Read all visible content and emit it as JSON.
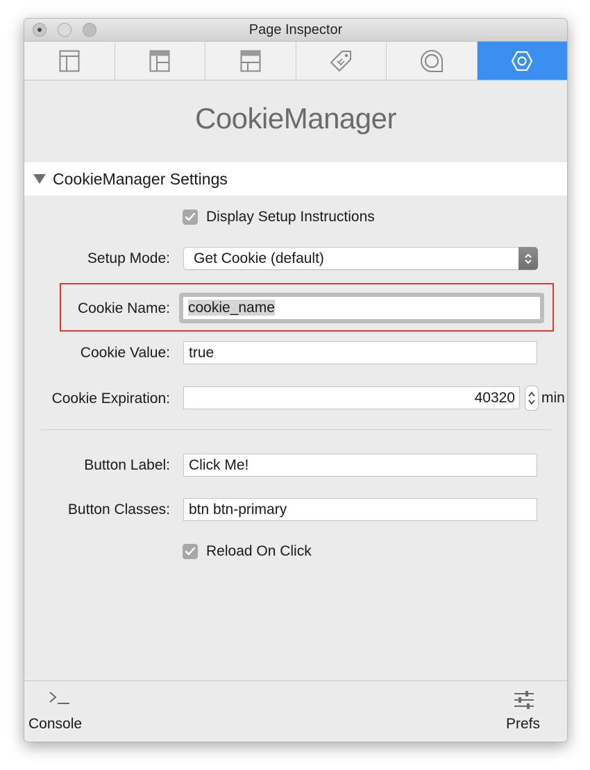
{
  "window": {
    "title": "Page Inspector"
  },
  "tabs": [
    {
      "icon": "layout-left-panel-icon",
      "active": false
    },
    {
      "icon": "layout-left-panel-top-icon",
      "active": false
    },
    {
      "icon": "layout-header-icon",
      "active": false
    },
    {
      "icon": "tag-icon",
      "active": false
    },
    {
      "icon": "speech-bubble-icon",
      "active": false
    },
    {
      "icon": "hexagon-plugin-icon",
      "active": true
    }
  ],
  "plugin": {
    "title": "CookieManager"
  },
  "section": {
    "title": "CookieManager Settings",
    "expanded": true
  },
  "fields": {
    "display_setup": {
      "label": "Display Setup Instructions",
      "checked": true
    },
    "setup_mode": {
      "label": "Setup Mode:",
      "value": "Get Cookie (default)"
    },
    "cookie_name": {
      "label": "Cookie Name:",
      "value": "cookie_name"
    },
    "cookie_value": {
      "label": "Cookie Value:",
      "value": "true"
    },
    "cookie_expiration": {
      "label": "Cookie Expiration:",
      "value": "40320",
      "unit": "min"
    },
    "button_label": {
      "label": "Button Label:",
      "value": "Click Me!"
    },
    "button_classes": {
      "label": "Button Classes:",
      "value": "btn btn-primary"
    },
    "reload_on_click": {
      "label": "Reload On Click",
      "checked": true
    }
  },
  "bottom": {
    "console_label": "Console",
    "prefs_label": "Prefs"
  },
  "colors": {
    "active_tab": "#3b8ff0",
    "highlight": "#e0392e"
  }
}
